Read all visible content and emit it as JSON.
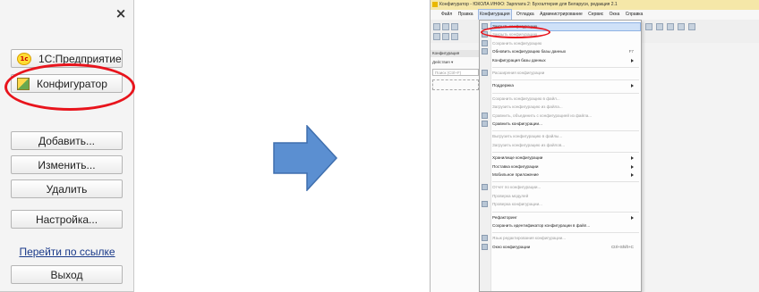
{
  "launcher": {
    "close_glyph": "×",
    "app_1c_label": "1С:Предприятие",
    "app_1c_icon": "1c",
    "app_cfg_label": "Конфигуратор",
    "buttons": [
      "Добавить...",
      "Изменить...",
      "Удалить",
      "Настройка..."
    ],
    "link": "Перейти по ссылке",
    "exit": "Выход"
  },
  "right": {
    "title": "Конфигуратор - ЮКОЛА ИНФО: Зарплата 2: Бухгалтерия для Беларуси, редакция 2.1",
    "menubar": [
      "Файл",
      "Правка",
      "Конфигурация",
      "Отладка",
      "Администрирование",
      "Сервис",
      "Окна",
      "Справка"
    ],
    "pane_header": "Конфигурация",
    "pane_actions": "Действия ▾",
    "pane_search": "Поиск (Ctrl+F)",
    "menu": [
      {
        "label": "Закрыть конфигурацию",
        "disabled": false,
        "highlight": true
      },
      {
        "label": "Закрыть конфигурацию",
        "disabled": true
      },
      {
        "label": "Сохранить конфигурацию",
        "disabled": true
      },
      {
        "label": "Обновить конфигурацию базы данных",
        "disabled": false,
        "shortcut": "F7"
      },
      {
        "label": "Конфигурация базы данных",
        "disabled": false,
        "submenu": true
      },
      {
        "sep": true
      },
      {
        "label": "Расширения конфигурации",
        "disabled": true
      },
      {
        "sep": true
      },
      {
        "label": "Поддержка",
        "disabled": false,
        "submenu": true
      },
      {
        "sep": true
      },
      {
        "label": "Сохранить конфигурацию в файл...",
        "disabled": true
      },
      {
        "label": "Загрузить конфигурацию из файла...",
        "disabled": true
      },
      {
        "label": "Сравнить, объединить с конфигурацией из файла...",
        "disabled": true
      },
      {
        "label": "Сравнить конфигурации...",
        "disabled": false
      },
      {
        "sep": true
      },
      {
        "label": "Выгрузить конфигурацию в файлы...",
        "disabled": true
      },
      {
        "label": "Загрузить конфигурацию из файлов...",
        "disabled": true
      },
      {
        "sep": true
      },
      {
        "label": "Хранилище конфигурации",
        "disabled": false,
        "submenu": true
      },
      {
        "label": "Поставка конфигурации",
        "disabled": false,
        "submenu": true
      },
      {
        "label": "Мобильное приложение",
        "disabled": false,
        "submenu": true
      },
      {
        "sep": true
      },
      {
        "label": "Отчет по конфигурации...",
        "disabled": true
      },
      {
        "label": "Проверка модулей",
        "disabled": true
      },
      {
        "label": "Проверка конфигурации...",
        "disabled": true
      },
      {
        "sep": true
      },
      {
        "label": "Рефакторинг",
        "disabled": false,
        "submenu": true
      },
      {
        "label": "Сохранить идентификатор конфигурации в файл...",
        "disabled": false
      },
      {
        "sep": true
      },
      {
        "label": "Язык редактирования конфигурации...",
        "disabled": true
      },
      {
        "label": "Окно конфигурации",
        "disabled": false,
        "shortcut": "Ctrl+Shift+C"
      }
    ]
  },
  "colors": {
    "highlight_ellipse": "#e8141c",
    "arrow_fill": "#5b8fd1",
    "arrow_stroke": "#3f6fae"
  }
}
